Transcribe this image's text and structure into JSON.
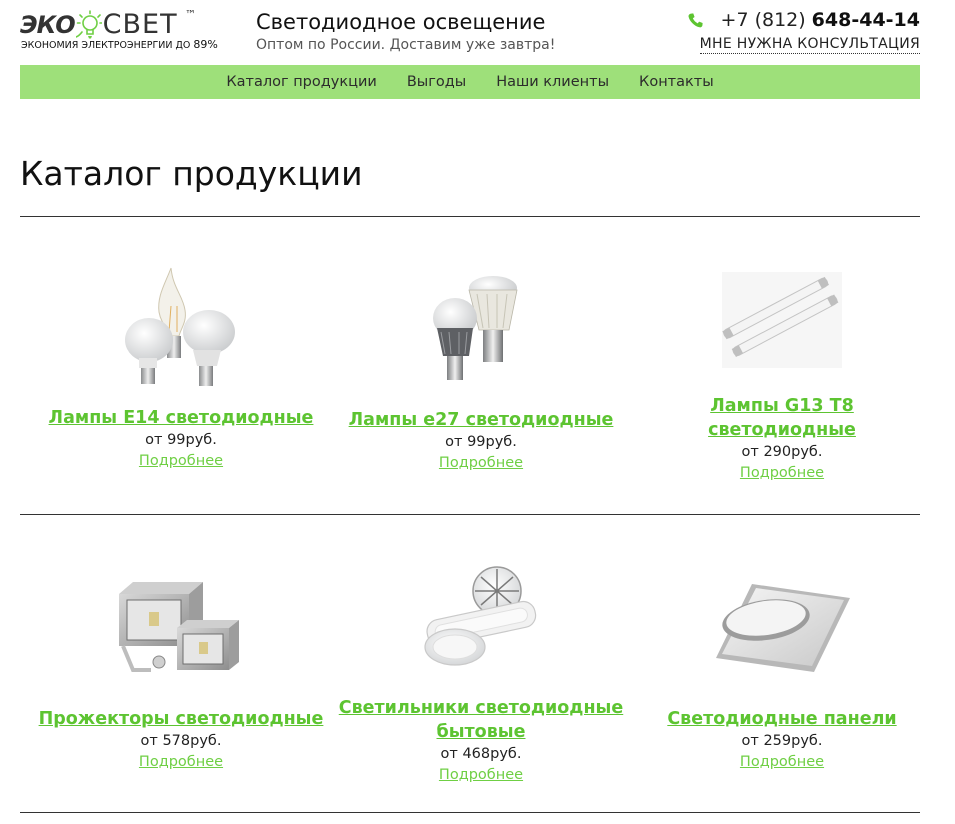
{
  "header": {
    "logo": {
      "left_text": "ЭКО",
      "right_text": "СВЕТ",
      "trademark": "™",
      "tagline_prefix": "ЭКОНОМИЯ ЭЛЕКТРОЭНЕРГИИ ДО",
      "tagline_value": "89%"
    },
    "title": "Светодиодное освещение",
    "subtitle": "Оптом по России. Доставим уже завтра!",
    "phone_prefix": "+7 (812)",
    "phone_number": "648-44-14",
    "consult_label": "МНЕ НУЖНА КОНСУЛЬТАЦИЯ"
  },
  "nav": {
    "items": [
      "Каталог продукции",
      "Выгоды",
      "Наши клиенты",
      "Контакты"
    ]
  },
  "page": {
    "title": "Каталог продукции"
  },
  "products": [
    {
      "name": "Лампы E14 светодиодные",
      "price": "от 99руб.",
      "more": "Подробнее"
    },
    {
      "name": "Лампы e27 светодиодные",
      "price": "от 99руб.",
      "more": "Подробнее"
    },
    {
      "name": "Лампы G13 T8 светодиодные",
      "price": "от 290руб.",
      "more": "Подробнее"
    },
    {
      "name": "Прожекторы светодиодные",
      "price": "от 578руб.",
      "more": "Подробнее"
    },
    {
      "name": "Светильники светодиодные бытовые",
      "price": "от 468руб.",
      "more": "Подробнее"
    },
    {
      "name": "Светодиодные панели",
      "price": "от 259руб.",
      "more": "Подробнее"
    }
  ],
  "colors": {
    "accent_green": "#5dc431",
    "nav_bg": "#9ee07a",
    "link_green": "#6fcf44"
  },
  "icons": {
    "phone": "phone-icon",
    "logo_bulb": "bulb-icon"
  }
}
